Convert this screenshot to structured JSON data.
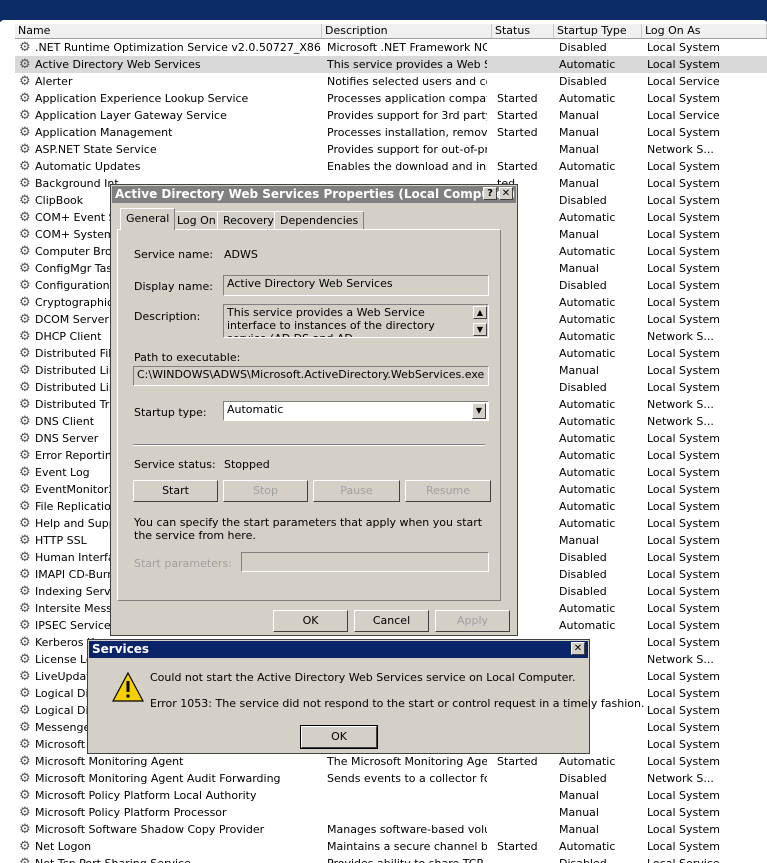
{
  "columns": {
    "name": "Name",
    "description": "Description",
    "status": "Status",
    "startup_type": "Startup Type",
    "log_on_as": "Log On As"
  },
  "services": [
    {
      "name": ".NET Runtime Optimization Service v2.0.50727_X86",
      "description": "Microsoft .NET Framework NGEN",
      "status": "",
      "startup": "Disabled",
      "logon": "Local System"
    },
    {
      "name": "Active Directory Web Services",
      "description": "This service provides a Web S...",
      "status": "",
      "startup": "Automatic",
      "logon": "Local System",
      "selected": true
    },
    {
      "name": "Alerter",
      "description": "Notifies selected users and co...",
      "status": "",
      "startup": "Disabled",
      "logon": "Local Service"
    },
    {
      "name": "Application Experience Lookup Service",
      "description": "Processes application compati...",
      "status": "Started",
      "startup": "Automatic",
      "logon": "Local System"
    },
    {
      "name": "Application Layer Gateway Service",
      "description": "Provides support for 3rd party...",
      "status": "Started",
      "startup": "Manual",
      "logon": "Local Service"
    },
    {
      "name": "Application Management",
      "description": "Processes installation, remova...",
      "status": "Started",
      "startup": "Manual",
      "logon": "Local System"
    },
    {
      "name": "ASP.NET State Service",
      "description": "Provides support for out-of-pr...",
      "status": "",
      "startup": "Manual",
      "logon": "Network S..."
    },
    {
      "name": "Automatic Updates",
      "description": "Enables the download and inst...",
      "status": "Started",
      "startup": "Automatic",
      "logon": "Local System"
    },
    {
      "name": "Background Int",
      "description": "",
      "status": "ted",
      "startup": "Manual",
      "logon": "Local System"
    },
    {
      "name": "ClipBook",
      "description": "",
      "status": "",
      "startup": "Disabled",
      "logon": "Local System"
    },
    {
      "name": "COM+ Event Sy",
      "description": "",
      "status": "ted",
      "startup": "Automatic",
      "logon": "Local System"
    },
    {
      "name": "COM+ System A",
      "description": "",
      "status": "ted",
      "startup": "Manual",
      "logon": "Local System"
    },
    {
      "name": "Computer Brow",
      "description": "",
      "status": "ted",
      "startup": "Automatic",
      "logon": "Local System"
    },
    {
      "name": "ConfigMgr Task",
      "description": "",
      "status": "",
      "startup": "Manual",
      "logon": "Local System"
    },
    {
      "name": "Configuration M",
      "description": "",
      "status": "",
      "startup": "Disabled",
      "logon": "Local System"
    },
    {
      "name": "Cryptographic S",
      "description": "",
      "status": "ted",
      "startup": "Automatic",
      "logon": "Local System"
    },
    {
      "name": "DCOM Server P",
      "description": "",
      "status": "ted",
      "startup": "Automatic",
      "logon": "Local System"
    },
    {
      "name": "DHCP Client",
      "description": "",
      "status": "ted",
      "startup": "Automatic",
      "logon": "Network S..."
    },
    {
      "name": "Distributed File",
      "description": "",
      "status": "ted",
      "startup": "Automatic",
      "logon": "Local System"
    },
    {
      "name": "Distributed Link",
      "description": "",
      "status": "",
      "startup": "Manual",
      "logon": "Local System"
    },
    {
      "name": "Distributed Link",
      "description": "",
      "status": "",
      "startup": "Disabled",
      "logon": "Local System"
    },
    {
      "name": "Distributed Tran",
      "description": "",
      "status": "ted",
      "startup": "Automatic",
      "logon": "Network S..."
    },
    {
      "name": "DNS Client",
      "description": "",
      "status": "ted",
      "startup": "Automatic",
      "logon": "Network S..."
    },
    {
      "name": "DNS Server",
      "description": "",
      "status": "ted",
      "startup": "Automatic",
      "logon": "Local System"
    },
    {
      "name": "Error Reporting",
      "description": "",
      "status": "ted",
      "startup": "Automatic",
      "logon": "Local System"
    },
    {
      "name": "Event Log",
      "description": "",
      "status": "ted",
      "startup": "Automatic",
      "logon": "Local System"
    },
    {
      "name": "EventMonitor2",
      "description": "",
      "status": "ted",
      "startup": "Automatic",
      "logon": "Local System"
    },
    {
      "name": "File Replication",
      "description": "",
      "status": "ted",
      "startup": "Automatic",
      "logon": "Local System"
    },
    {
      "name": "Help and Suppo",
      "description": "",
      "status": "ted",
      "startup": "Automatic",
      "logon": "Local System"
    },
    {
      "name": "HTTP SSL",
      "description": "",
      "status": "",
      "startup": "Manual",
      "logon": "Local System"
    },
    {
      "name": "Human Interfac",
      "description": "",
      "status": "",
      "startup": "Disabled",
      "logon": "Local System"
    },
    {
      "name": "IMAPI CD-Burni",
      "description": "",
      "status": "",
      "startup": "Disabled",
      "logon": "Local System"
    },
    {
      "name": "Indexing Servic",
      "description": "",
      "status": "",
      "startup": "Disabled",
      "logon": "Local System"
    },
    {
      "name": "Intersite Messa",
      "description": "",
      "status": "ted",
      "startup": "Automatic",
      "logon": "Local System"
    },
    {
      "name": "IPSEC Services",
      "description": "",
      "status": "ted",
      "startup": "Automatic",
      "logon": "Local System"
    },
    {
      "name": "Kerberos K",
      "description": "",
      "status": "",
      "startup": "",
      "logon": "Local System"
    },
    {
      "name": "License Log",
      "description": "",
      "status": "",
      "startup": "",
      "logon": "Network S..."
    },
    {
      "name": "LiveUpdate",
      "description": "",
      "status": "",
      "startup": "",
      "logon": "Local System"
    },
    {
      "name": "Logical Disk",
      "description": "",
      "status": "",
      "startup": "atic",
      "logon": "Local System"
    },
    {
      "name": "Logical Disk",
      "description": "",
      "status": "",
      "startup": "",
      "logon": "Local System"
    },
    {
      "name": "Messenger",
      "description": "",
      "status": "",
      "startup": "ed",
      "logon": "Local System"
    },
    {
      "name": "Microsoft .",
      "description": "",
      "status": "",
      "startup": "atic",
      "logon": "Local System"
    },
    {
      "name": "Microsoft Monitoring Agent",
      "description": "The Microsoft Monitoring Agen...",
      "status": "Started",
      "startup": "Automatic",
      "logon": "Local System"
    },
    {
      "name": "Microsoft Monitoring Agent Audit Forwarding",
      "description": "Sends events to a collector fo...",
      "status": "",
      "startup": "Disabled",
      "logon": "Network S..."
    },
    {
      "name": "Microsoft Policy Platform Local Authority",
      "description": "",
      "status": "",
      "startup": "Manual",
      "logon": "Local System"
    },
    {
      "name": "Microsoft Policy Platform Processor",
      "description": "",
      "status": "",
      "startup": "Manual",
      "logon": "Local System"
    },
    {
      "name": "Microsoft Software Shadow Copy Provider",
      "description": "Manages software-based volu...",
      "status": "",
      "startup": "Manual",
      "logon": "Local System"
    },
    {
      "name": "Net Logon",
      "description": "Maintains a secure channel be...",
      "status": "Started",
      "startup": "Automatic",
      "logon": "Local System"
    },
    {
      "name": "Net.Tcp Port Sharing Service",
      "description": "Provides ability to share TCP...",
      "status": "",
      "startup": "Disabled",
      "logon": "Local Service"
    }
  ],
  "properties": {
    "title": "Active Directory Web Services Properties (Local Computer)",
    "tabs": [
      "General",
      "Log On",
      "Recovery",
      "Dependencies"
    ],
    "service_name_label": "Service name:",
    "service_name": "ADWS",
    "display_name_label": "Display name:",
    "display_name": "Active Directory Web Services",
    "description_label": "Description:",
    "description": "This service provides a Web Service interface to instances of the directory service (AD DS and AD",
    "path_label": "Path to executable:",
    "path": "C:\\WINDOWS\\ADWS\\Microsoft.ActiveDirectory.WebServices.exe",
    "startup_label": "Startup type:",
    "startup_value": "Automatic",
    "status_label": "Service status:",
    "status_value": "Stopped",
    "start": "Start",
    "stop": "Stop",
    "pause": "Pause",
    "resume": "Resume",
    "hint": "You can specify the start parameters that apply when you start the service from here.",
    "params_label": "Start parameters:",
    "ok": "OK",
    "cancel": "Cancel",
    "apply": "Apply"
  },
  "error": {
    "title": "Services",
    "line1": "Could not start the Active Directory Web Services service on Local Computer.",
    "line2": "Error 1053: The service did not respond to the start or control request in a timely fashion.",
    "ok": "OK"
  },
  "colors": {
    "selected_row": "#d9d9d9",
    "dialog_face": "#d4d0c8",
    "inactive_title": "#808080",
    "warning_yellow": "#f6d000"
  }
}
